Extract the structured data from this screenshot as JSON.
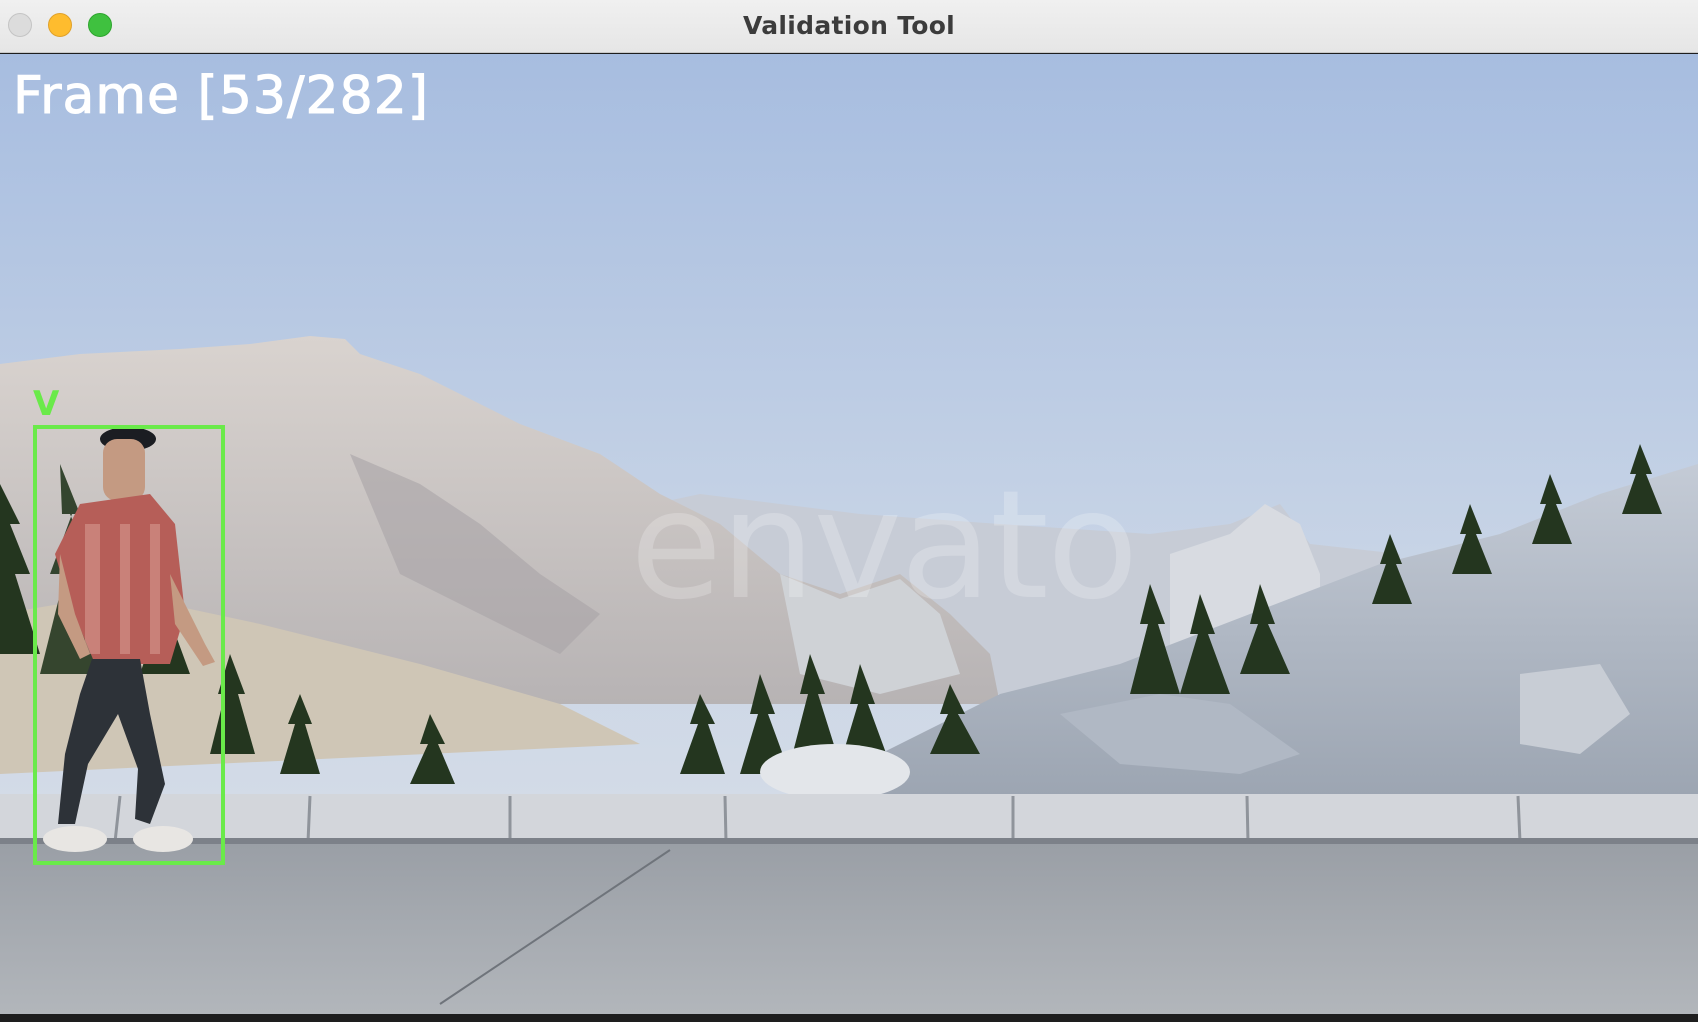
{
  "window": {
    "title": "Validation Tool",
    "controls": {
      "close": {
        "icon": "close-traffic-light-icon",
        "color": "#dcdcdc"
      },
      "minimize": {
        "icon": "minimize-traffic-light-icon",
        "color": "#febc2e"
      },
      "maximize": {
        "icon": "maximize-traffic-light-icon",
        "color": "#3fc13f"
      }
    }
  },
  "overlay": {
    "frame_counter": "Frame [53/282]",
    "detections": [
      {
        "label": "V",
        "color": "#6aea4a"
      }
    ]
  },
  "video": {
    "watermark": "envato"
  }
}
